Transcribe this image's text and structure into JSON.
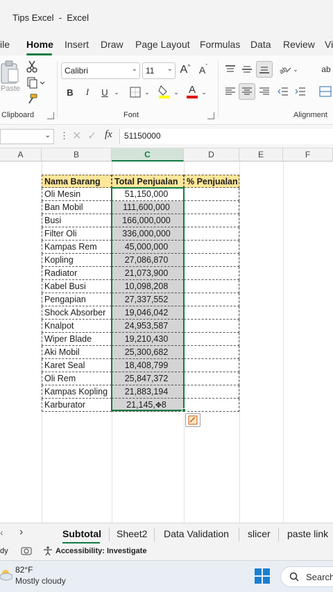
{
  "window": {
    "title": "Tips Excel  -  Excel"
  },
  "ribbon_tabs": [
    "ile",
    "Home",
    "Insert",
    "Draw",
    "Page Layout",
    "Formulas",
    "Data",
    "Review",
    "Vi"
  ],
  "ribbon": {
    "paste_label": "Paste",
    "clipboard_group": "Clipboard",
    "font_group": "Font",
    "alignment_group": "Alignment",
    "font_name": "Calibri",
    "font_size": "11",
    "grow_font": "A",
    "shrink_font": "A",
    "bold": "B",
    "italic": "I",
    "underline": "U",
    "font_color_letter": "A",
    "wrap_label": "ab"
  },
  "formula_bar": {
    "fx": "fx",
    "value": "51150000"
  },
  "columns": [
    "A",
    "B",
    "C",
    "D",
    "E",
    "F"
  ],
  "table": {
    "headers": [
      "Nama Barang",
      "Total Penjualan",
      "% Penjualan"
    ],
    "rows": [
      {
        "name": "Oli Mesin",
        "value": "51,150,000"
      },
      {
        "name": "Ban Mobil",
        "value": "111,600,000"
      },
      {
        "name": "Busi",
        "value": "166,000,000"
      },
      {
        "name": "Filter Oli",
        "value": "336,000,000"
      },
      {
        "name": "Kampas Rem",
        "value": "45,000,000"
      },
      {
        "name": "Kopling",
        "value": "27,086,870"
      },
      {
        "name": "Radiator",
        "value": "21,073,900"
      },
      {
        "name": "Kabel Busi",
        "value": "10,098,208"
      },
      {
        "name": "Pengapian",
        "value": "27,337,552"
      },
      {
        "name": "Shock Absorber",
        "value": "19,046,042"
      },
      {
        "name": "Knalpot",
        "value": "24,953,587"
      },
      {
        "name": "Wiper Blade",
        "value": "19,210,430"
      },
      {
        "name": "Aki Mobil",
        "value": "25,300,682"
      },
      {
        "name": "Karet Seal",
        "value": "18,408,799"
      },
      {
        "name": "Oli Rem",
        "value": "25,847,372"
      },
      {
        "name": "Kampas Kopling",
        "value": "21,883,194"
      },
      {
        "name": "Karburator",
        "value": "21,145,"
      }
    ],
    "last_value_tail": "8"
  },
  "sheet_tabs": [
    "Subtotal",
    "Sheet2",
    "Data Validation",
    "slicer",
    "paste link"
  ],
  "status": {
    "ready": "dy",
    "accessibility": "Accessibility: Investigate"
  },
  "taskbar": {
    "temperature": "82°F",
    "weather": "Mostly cloudy",
    "search": "Search"
  },
  "colors": {
    "excel_green": "#107c41",
    "header_fill": "#ffe699",
    "selection_fill": "#d4d4d4"
  }
}
